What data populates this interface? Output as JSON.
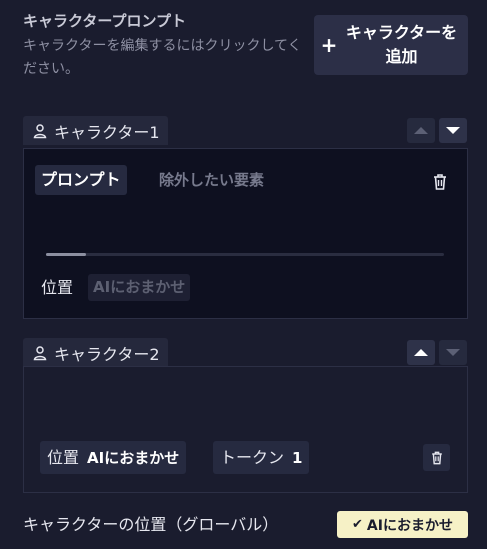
{
  "header": {
    "title": "キャラクタープロンプト",
    "subtitle": "キャラクターを編集するにはクリックしてください。",
    "add_button": {
      "icon": "plus-icon",
      "plus": "+",
      "label": "キャラクターを追加"
    }
  },
  "characters": [
    {
      "name": "キャラクター1",
      "icon": "person-icon",
      "tabs": [
        {
          "label": "プロンプト",
          "active": true
        },
        {
          "label": "除外したい要素",
          "active": false
        }
      ],
      "slider": {
        "value": 0.1
      },
      "position": {
        "label": "位置",
        "value": "AIにおまかせ"
      }
    },
    {
      "name": "キャラクター2",
      "icon": "person-icon",
      "position": {
        "label": "位置",
        "value": "AIにおまかせ"
      },
      "tokens": {
        "label": "トークン",
        "count": "1"
      }
    }
  ],
  "global_position": {
    "label": "キャラクターの位置（グローバル）",
    "check": "✔",
    "value": "AIにおまかせ"
  },
  "colors": {
    "background": "#1a1c2e",
    "panel": "#0e1020",
    "chip": "#262a40",
    "highlight_chip": "#f6f1c6"
  }
}
